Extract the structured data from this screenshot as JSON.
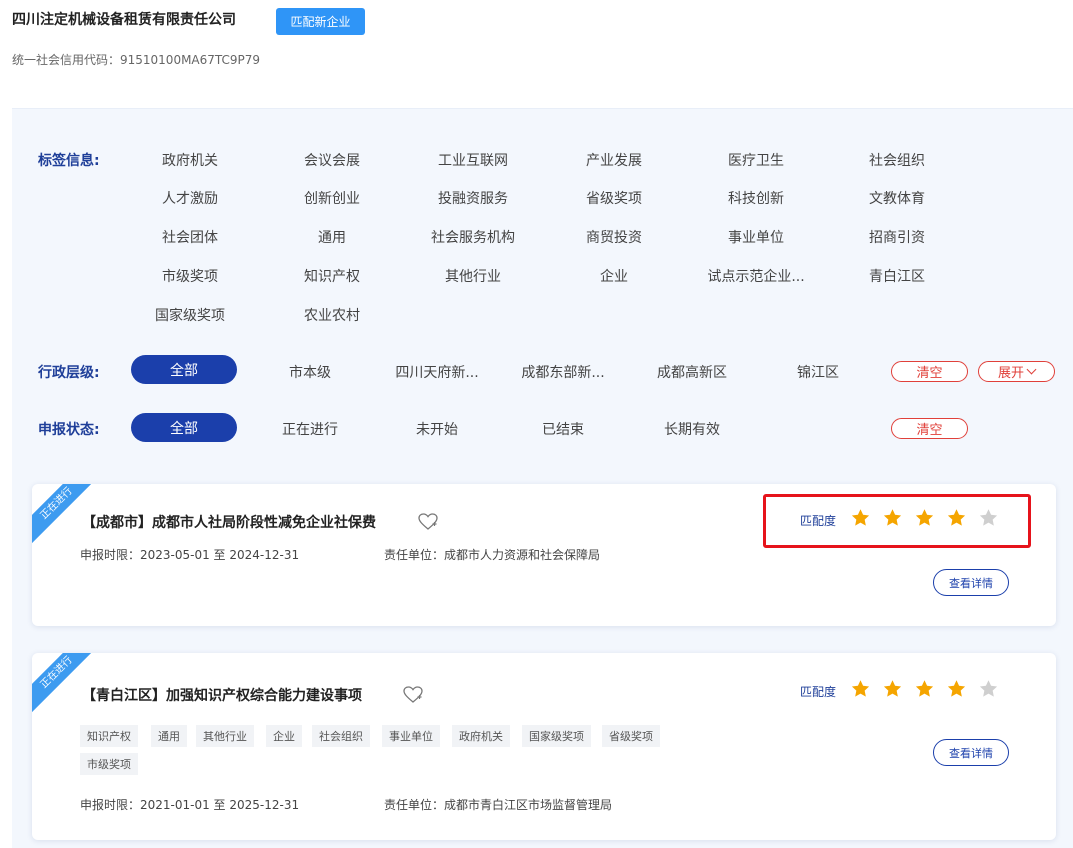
{
  "company": {
    "name": "四川注定机械设备租赁有限责任公司",
    "match_button": "匹配新企业",
    "credit_code": "统一社会信用代码：91510100MA67TC9P79"
  },
  "filters": {
    "tag_label": "标签信息:",
    "tags": [
      "政府机关",
      "会议会展",
      "工业互联网",
      "产业发展",
      "医疗卫生",
      "社会组织",
      "人才激励",
      "创新创业",
      "投融资服务",
      "省级奖项",
      "科技创新",
      "文教体育",
      "社会团体",
      "通用",
      "社会服务机构",
      "商贸投资",
      "事业单位",
      "招商引资",
      "市级奖项",
      "知识产权",
      "其他行业",
      "企业",
      "试点示范企业...",
      "青白江区",
      "国家级奖项",
      "农业农村"
    ],
    "admin_label": "行政层级:",
    "admin_options": [
      "全部",
      "市本级",
      "四川天府新...",
      "成都东部新...",
      "成都高新区",
      "锦江区"
    ],
    "admin_clear": "清空",
    "admin_expand": "展开",
    "status_label": "申报状态:",
    "status_options": [
      "全部",
      "正在进行",
      "未开始",
      "已结束",
      "长期有效"
    ],
    "status_clear": "清空"
  },
  "cards": [
    {
      "ribbon": "正在进行",
      "title": "【成都市】成都市人社局阶段性减免企业社保费",
      "period": "申报时限：2023-05-01 至 2024-12-31",
      "unit": "责任单位：成都市人力资源和社会保障局",
      "match_label": "匹配度",
      "match_stars": 4,
      "detail_button": "查看详情",
      "tags": []
    },
    {
      "ribbon": "正在进行",
      "title": "【青白江区】加强知识产权综合能力建设事项",
      "period": "申报时限：2021-01-01 至 2025-12-31",
      "unit": "责任单位：成都市青白江区市场监督管理局",
      "match_label": "匹配度",
      "match_stars": 4,
      "detail_button": "查看详情",
      "tags": [
        "知识产权",
        "通用",
        "其他行业",
        "企业",
        "社会组织",
        "事业单位",
        "政府机关",
        "国家级奖项",
        "省级奖项",
        "市级奖项"
      ]
    }
  ],
  "colors": {
    "accent": "#1b3fab",
    "highlight": "#e6131b",
    "star": "#f5a500",
    "star_empty": "#cfcfcf"
  }
}
